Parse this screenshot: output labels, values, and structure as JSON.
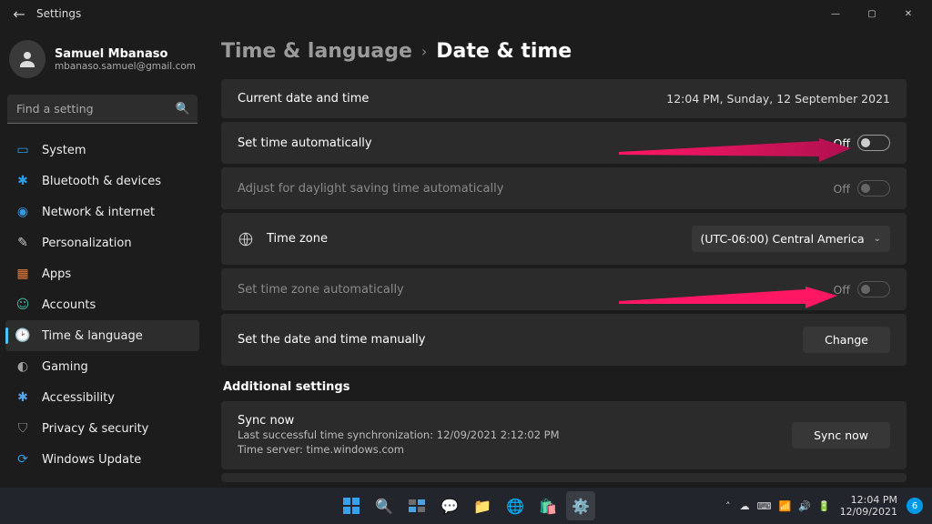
{
  "window": {
    "title": "Settings"
  },
  "user": {
    "name": "Samuel Mbanaso",
    "email": "mbanaso.samuel@gmail.com"
  },
  "search": {
    "placeholder": "Find a setting"
  },
  "nav": {
    "items": [
      {
        "label": "System",
        "icon": "▭"
      },
      {
        "label": "Bluetooth & devices",
        "icon": "✱"
      },
      {
        "label": "Network & internet",
        "icon": "◉"
      },
      {
        "label": "Personalization",
        "icon": "✎"
      },
      {
        "label": "Apps",
        "icon": "▦"
      },
      {
        "label": "Accounts",
        "icon": "☺"
      },
      {
        "label": "Time & language",
        "icon": "🕑"
      },
      {
        "label": "Gaming",
        "icon": "◐"
      },
      {
        "label": "Accessibility",
        "icon": "✱"
      },
      {
        "label": "Privacy & security",
        "icon": "⛉"
      },
      {
        "label": "Windows Update",
        "icon": "⟳"
      }
    ],
    "active_index": 6
  },
  "breadcrumb": {
    "parent": "Time & language",
    "current": "Date & time"
  },
  "rows": {
    "current_label": "Current date and time",
    "current_value": "12:04 PM, Sunday, 12 September 2021",
    "set_time_auto": "Set time automatically",
    "set_time_auto_state": "Off",
    "dst_auto": "Adjust for daylight saving time automatically",
    "dst_auto_state": "Off",
    "timezone_label": "Time zone",
    "timezone_value": "(UTC-06:00) Central America",
    "set_tz_auto": "Set time zone automatically",
    "set_tz_auto_state": "Off",
    "set_manual": "Set the date and time manually",
    "change_btn": "Change"
  },
  "additional": {
    "heading": "Additional settings",
    "sync_title": "Sync now",
    "sync_line1": "Last successful time synchronization: 12/09/2021 2:12:02 PM",
    "sync_line2": "Time server: time.windows.com",
    "sync_btn": "Sync now"
  },
  "taskbar": {
    "systray_chevron": "˄",
    "clock_time": "12:04 PM",
    "clock_date": "12/09/2021",
    "notif_count": "6"
  }
}
